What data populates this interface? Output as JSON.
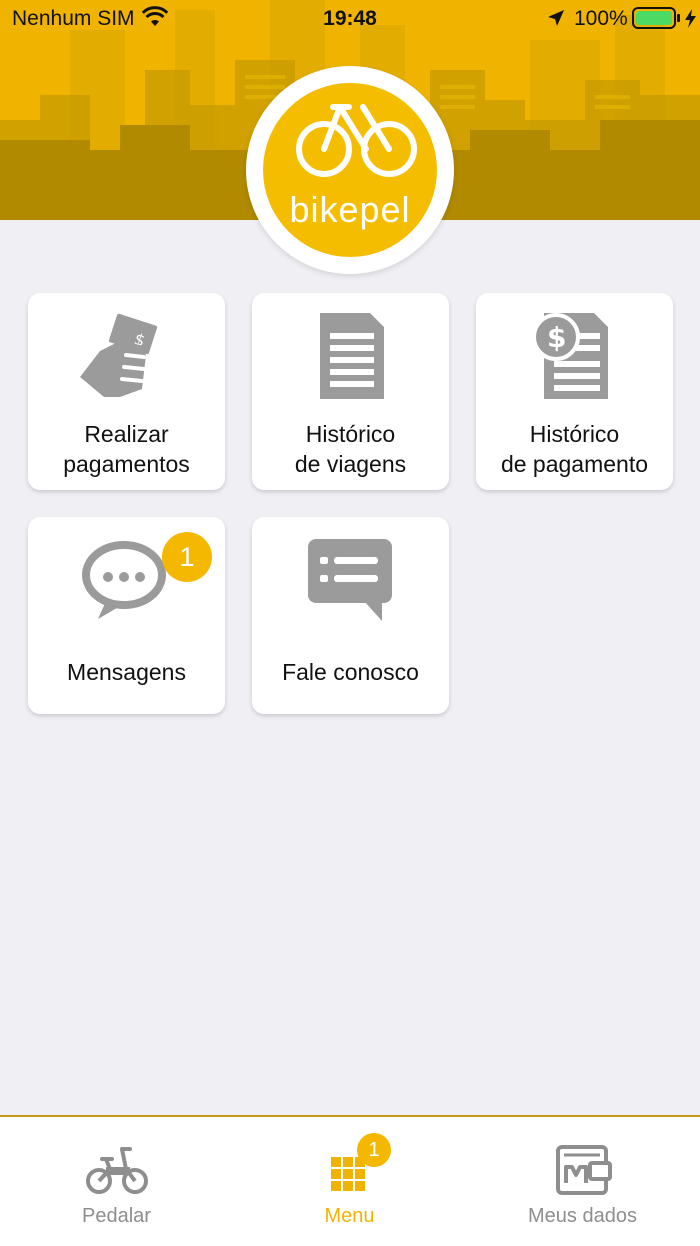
{
  "status_bar": {
    "carrier": "Nenhum SIM",
    "time": "19:48",
    "battery_percent": "100%",
    "icons": [
      "wifi-icon",
      "location-arrow-icon",
      "battery-icon",
      "charging-bolt-icon"
    ]
  },
  "header": {
    "logo_text": "bikepel",
    "background_color": "#f0b400",
    "logo_color": "#f5bd00"
  },
  "menu": {
    "items": [
      {
        "line1": "Realizar",
        "line2": "pagamentos",
        "icon": "hand-money-icon"
      },
      {
        "line1": "Histórico",
        "line2": "de viagens",
        "icon": "document-icon"
      },
      {
        "line1": "Histórico",
        "line2": "de pagamento",
        "icon": "dollar-document-icon"
      },
      {
        "line1": "Mensagens",
        "icon": "chat-bubble-icon",
        "badge": "1"
      },
      {
        "line1": "Fale conosco",
        "icon": "message-icon"
      }
    ]
  },
  "tabbar": {
    "tabs": [
      {
        "label": "Pedalar",
        "icon": "bike-icon",
        "active": false
      },
      {
        "label": "Menu",
        "icon": "grid-icon",
        "active": true,
        "badge": "1"
      },
      {
        "label": "Meus dados",
        "icon": "wallet-card-icon",
        "active": false
      }
    ],
    "active_color": "#f0b400",
    "inactive_color": "#8e8e8e"
  }
}
